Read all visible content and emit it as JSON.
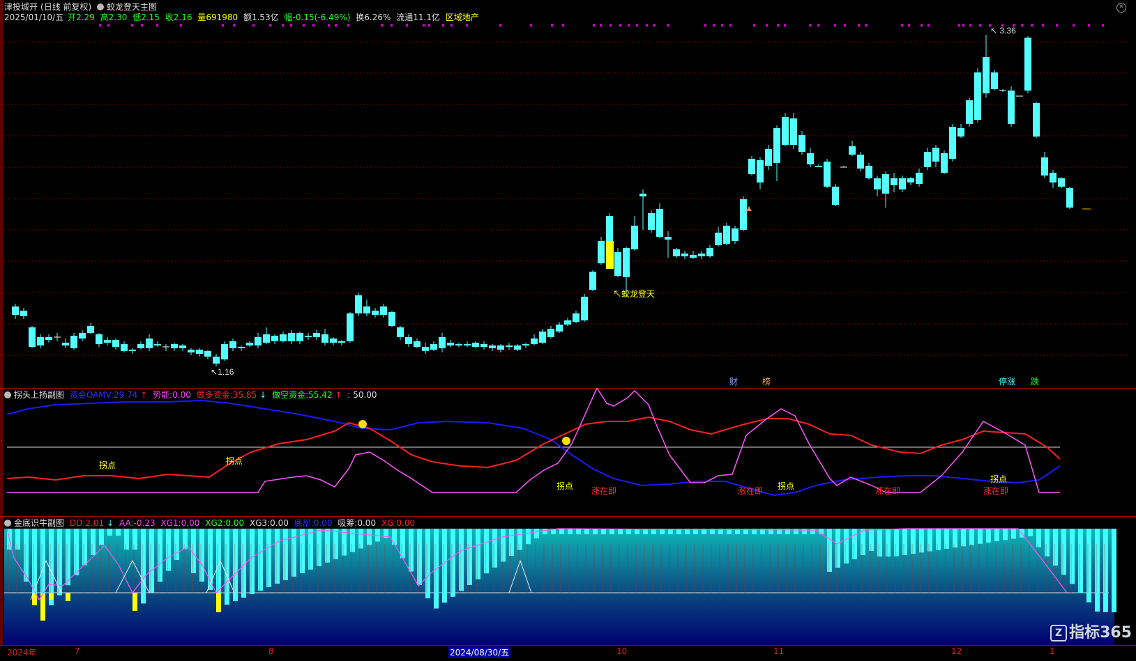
{
  "header": {
    "stock": "津投城开",
    "period": "(日线 前复权)",
    "indicator": "蛟龙登天主图",
    "date": "2025/01/10/五",
    "open_label": "开",
    "open": "2.29",
    "high_label": "高",
    "high": "2.30",
    "low_label": "低",
    "low": "2.15",
    "close_label": "收",
    "close": "2.16",
    "vol_label": "量",
    "vol": "691980",
    "amt_label": "额",
    "amt": "1.53亿",
    "chg_label": "幅",
    "chg": "-0.15(-6.49%)",
    "turn_label": "换",
    "turn": "6.26%",
    "float_label": "流通",
    "float": "11.1亿",
    "sector": "区域地产"
  },
  "main_annotations": {
    "high_price": "3.36",
    "low_price": "1.16",
    "signal": "蛟龙登天",
    "tag_cai": "财",
    "tag_bang": "榜",
    "tag_tingzhang": "停涨",
    "tag_die": "跌"
  },
  "sub1": {
    "title": "拐头上扬副图",
    "f1_label": "资金OAMV:",
    "f1_value": "29.74",
    "f2_label": "势能:",
    "f2_value": "0.00",
    "f3_label": "做多资金:",
    "f3_value": "35.85",
    "f4_label": "做空资金:",
    "f4_value": "55.42",
    "f5_value": ": 50.00",
    "labels_guaidian": "拐点",
    "labels_zhang": "涨在即"
  },
  "sub2": {
    "title": "金底识牛副图",
    "f1_label": "DD:",
    "f1_value": "2.01",
    "f2_label": "AA:",
    "f2_value": "-0.23",
    "f3_label": "XG1:",
    "f3_value": "0.00",
    "f4_label": "XG2:",
    "f4_value": "0.00",
    "f5_label": "XG3:",
    "f5_value": "0.00",
    "f6_label": "底部:",
    "f6_value": "0.00",
    "f7_label": "吸筹:",
    "f7_value": "0.00",
    "f8_label": "XG:",
    "f8_value": "0.00"
  },
  "xaxis": {
    "labels": [
      "2024年",
      "7",
      "8",
      "2024/08/30/五",
      "10",
      "11",
      "12",
      "1"
    ]
  },
  "logo": "指标365",
  "colors": {
    "up": "#ff3333",
    "down": "#54ffff",
    "grid": "#800000",
    "red_line": "#ff2020",
    "blue_line": "#1a1aff",
    "pink_line": "#ff55ff"
  },
  "chart_data": {
    "type": "candlestick",
    "price_high": 3.36,
    "price_low": 1.16
  }
}
